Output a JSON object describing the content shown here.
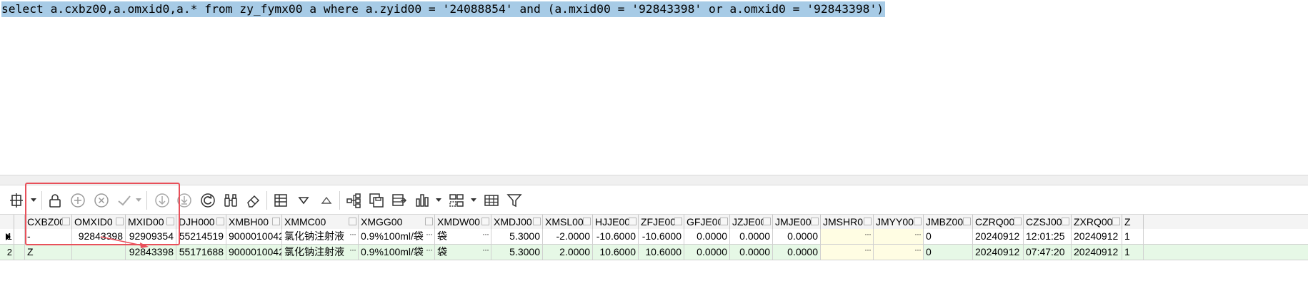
{
  "editor": {
    "sql": "select a.cxbz00,a.omxid0,a.* from zy_fymx00 a where a.zyid00 = '24088854' and (a.mxid00 = '92843398' or a.omxid0 = '92843398')"
  },
  "toolbar": {
    "icons": [
      "grid-navigator-icon",
      "lock-icon",
      "add-record-icon",
      "delete-record-icon",
      "post-edit-icon",
      "fetch-next-icon",
      "fetch-all-icon",
      "refresh-icon",
      "find-icon",
      "clear-icon",
      "export-icon",
      "sort-desc-icon",
      "sort-asc-icon",
      "tree-view-icon",
      "save-icon",
      "import-icon",
      "chart-icon",
      "layout-icon",
      "table-icon",
      "filter-icon"
    ]
  },
  "grid": {
    "columns": [
      "CXBZ00",
      "OMXID0",
      "MXID00",
      "DJH000",
      "XMBH00",
      "XMMC00",
      "XMGG00",
      "XMDW00",
      "XMDJ00",
      "XMSL00",
      "HJJE00",
      "ZFJE00",
      "GFJE00",
      "JZJE00",
      "JMJE00",
      "JMSHR0",
      "JMYY00",
      "JMBZ00",
      "CZRQ00",
      "CZSJ00",
      "ZXRQ00",
      "Z"
    ],
    "rows": [
      {
        "index": "1",
        "cells": [
          "-",
          "92843398",
          "92909354",
          "55214519",
          "9000010042",
          "氯化钠注射液",
          "0.9%100ml/袋",
          "袋",
          "5.3000",
          "-2.0000",
          "-10.6000",
          "-10.6000",
          "0.0000",
          "0.0000",
          "0.0000",
          "",
          "",
          "0",
          "20240912",
          "12:01:25",
          "20240912",
          "1"
        ]
      },
      {
        "index": "2",
        "cells": [
          "Z",
          "",
          "92843398",
          "55171688",
          "9000010042",
          "氯化钠注射液",
          "0.9%100ml/袋",
          "袋",
          "5.3000",
          "2.0000",
          "10.6000",
          "10.6000",
          "0.0000",
          "0.0000",
          "0.0000",
          "",
          "",
          "0",
          "20240912",
          "07:47:20",
          "20240912",
          "1"
        ]
      }
    ],
    "ellipsis": "···"
  },
  "colors": {
    "selection": "#a7cbe6",
    "row2_bg": "#e6f8e6",
    "highlight_box": "#e8505a"
  }
}
